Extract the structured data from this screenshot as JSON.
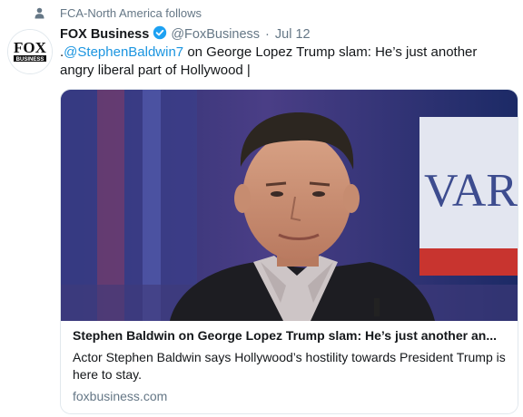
{
  "context": {
    "text": "FCA-North America follows",
    "icon": "person-icon"
  },
  "tweet": {
    "avatar_text": "FOX",
    "avatar_subtext": "BUSINESS",
    "name": "FOX Business",
    "verified_icon": "verified-badge-icon",
    "handle": "@FoxBusiness",
    "separator": "·",
    "date": "Jul 12",
    "text_prefix": ".",
    "mention": "@StephenBaldwin7",
    "text_body": " on George Lopez Trump slam: He’s just another angry liberal part of Hollywood  |"
  },
  "card": {
    "image_sign": "VARN",
    "title": "Stephen Baldwin on George Lopez Trump slam: He’s just another an...",
    "description": "Actor Stephen Baldwin says Hollywood’s hostility towards President Trump is here to stay.",
    "domain": "foxbusiness.com"
  },
  "colors": {
    "link": "#1b95e0",
    "secondary": "#657786",
    "border": "#e1e8ed",
    "verified": "#1da1f2"
  }
}
